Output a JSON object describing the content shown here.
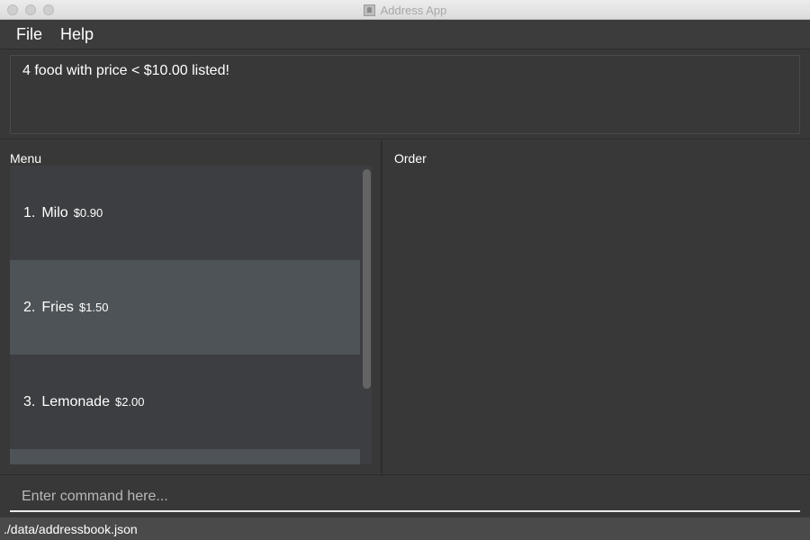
{
  "window": {
    "title": "Address App"
  },
  "menubar": {
    "items": [
      {
        "label": "File"
      },
      {
        "label": "Help"
      }
    ]
  },
  "result": {
    "message": "4 food with price < $10.00 listed!"
  },
  "menu_panel": {
    "label": "Menu",
    "items": [
      {
        "index": "1.",
        "name": "Milo",
        "price": "$0.90"
      },
      {
        "index": "2.",
        "name": "Fries",
        "price": "$1.50"
      },
      {
        "index": "3.",
        "name": "Lemonade",
        "price": "$2.00"
      }
    ]
  },
  "order_panel": {
    "label": "Order"
  },
  "command": {
    "placeholder": "Enter command here..."
  },
  "status": {
    "file_path": "./data/addressbook.json"
  }
}
